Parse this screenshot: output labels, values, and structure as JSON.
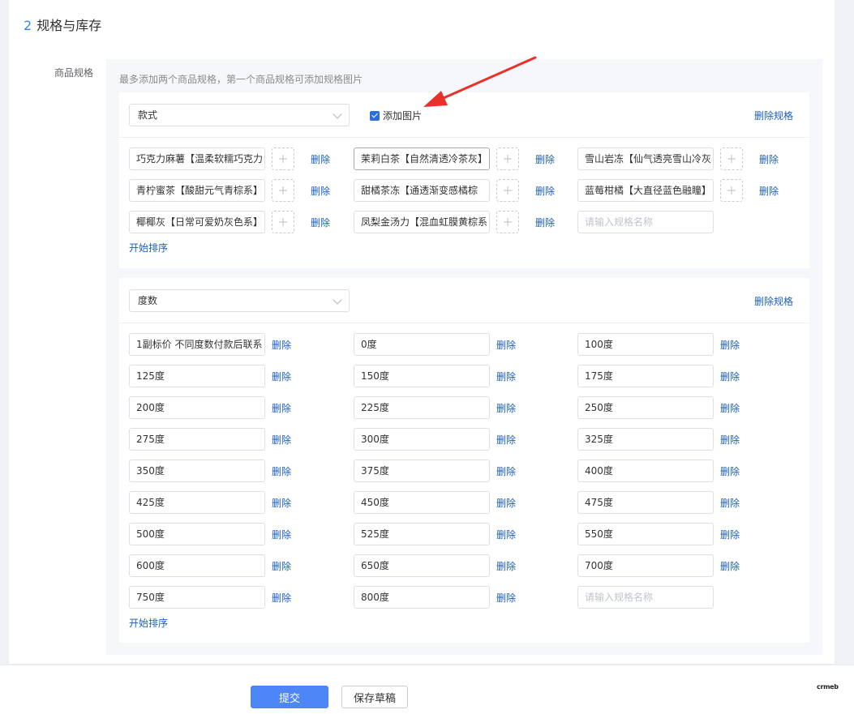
{
  "section": {
    "number": "2",
    "title": "规格与库存"
  },
  "form_label": "商品规格",
  "hint": "最多添加两个商品规格，第一个商品规格可添加规格图片",
  "groups": [
    {
      "spec_name": "款式",
      "add_image_label": "添加图片",
      "add_image_checked": true,
      "delete_spec_label": "删除规格",
      "item_delete_label": "删除",
      "items": [
        "巧克力麻薯【温柔软糯巧克力",
        "茉莉白茶【自然清透冷茶灰】",
        "雪山岩冻【仙气透亮雪山冷灰",
        "青柠蜜茶【酸甜元气青棕系】",
        "甜橘茶冻【通透渐变感橘棕",
        "蓝莓柑橘【大直径蓝色融瞳】",
        "椰椰灰【日常可爱奶灰色系】",
        "凤梨金汤力【混血虹膜黄棕系"
      ],
      "new_item_placeholder": "请输入规格名称",
      "sort_label": "开始排序"
    },
    {
      "spec_name": "度数",
      "delete_spec_label": "删除规格",
      "item_delete_label": "删除",
      "items": [
        "1副标价 不同度数付款后联系",
        "0度",
        "100度",
        "125度",
        "150度",
        "175度",
        "200度",
        "225度",
        "250度",
        "275度",
        "300度",
        "325度",
        "350度",
        "375度",
        "400度",
        "425度",
        "450度",
        "475度",
        "500度",
        "525度",
        "550度",
        "600度",
        "650度",
        "700度",
        "750度",
        "800度"
      ],
      "new_item_placeholder": "请输入规格名称",
      "sort_label": "开始排序"
    }
  ],
  "footer": {
    "submit_label": "提交",
    "draft_label": "保存草稿",
    "brand": "crmeb"
  },
  "colors": {
    "primary": "#4d86f7",
    "link": "#1c5fba",
    "annotation_arrow": "#e8312a"
  }
}
